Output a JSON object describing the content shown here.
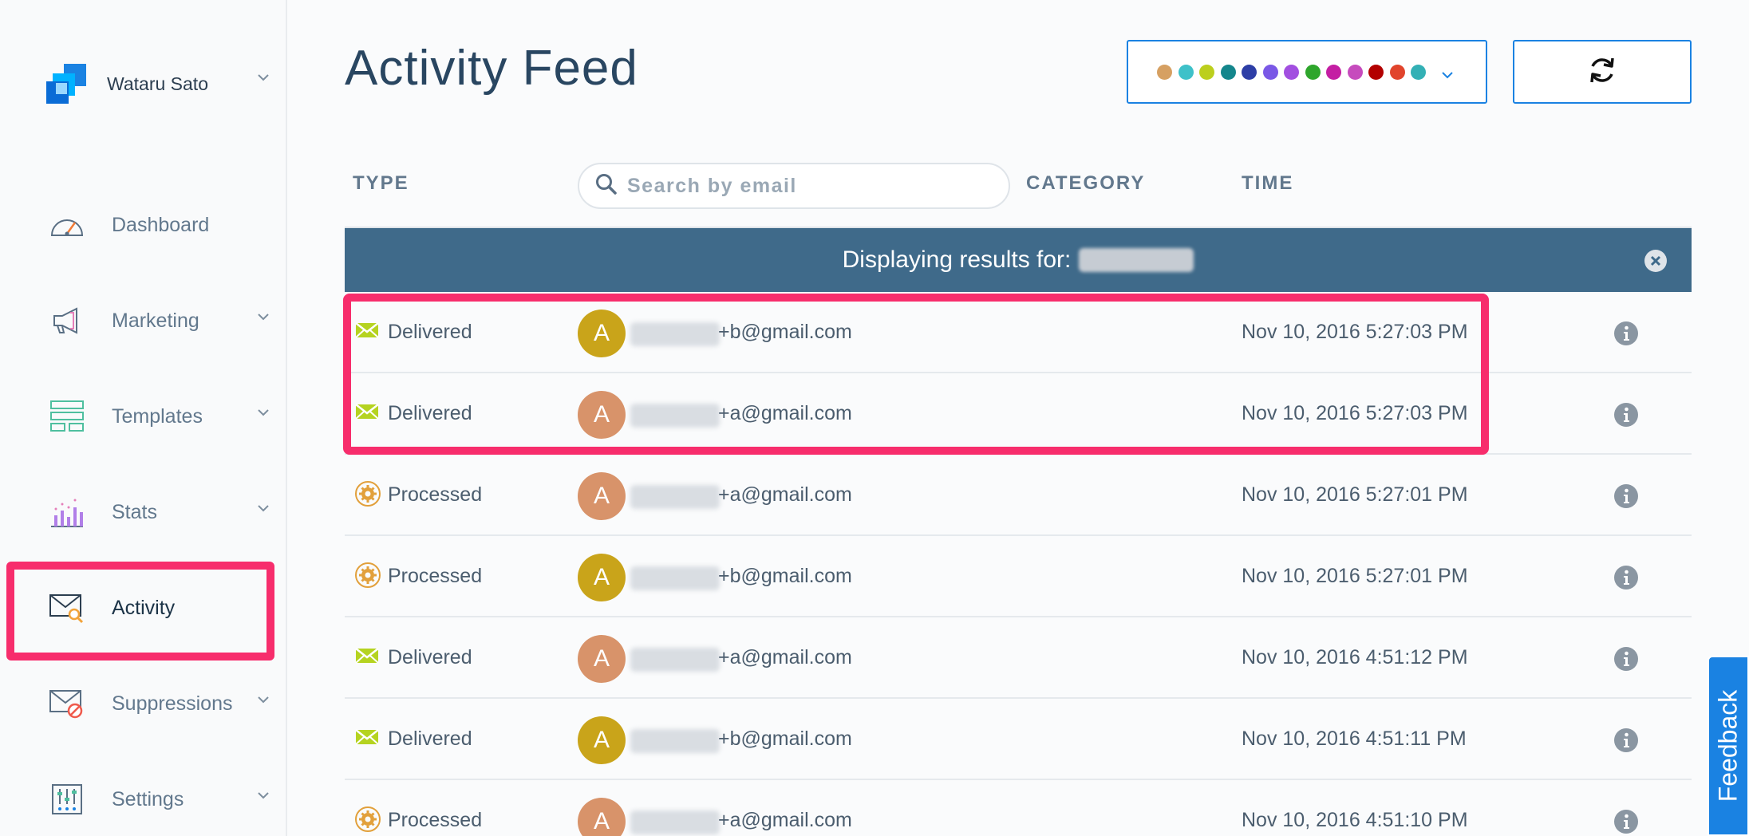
{
  "account": {
    "name": "Wataru Sato"
  },
  "nav": [
    {
      "label": "Dashboard"
    },
    {
      "label": "Marketing"
    },
    {
      "label": "Templates"
    },
    {
      "label": "Stats"
    },
    {
      "label": "Activity"
    },
    {
      "label": "Suppressions"
    },
    {
      "label": "Settings"
    }
  ],
  "header": {
    "title": "Activity Feed",
    "filter_colors": [
      "#d6a062",
      "#3ec1c9",
      "#bccf1d",
      "#14868c",
      "#2d3ea6",
      "#7a58e6",
      "#a24fe0",
      "#2ea62c",
      "#c41ea3",
      "#c64bbd",
      "#b30000",
      "#e1442c",
      "#33b0b5"
    ]
  },
  "columns": {
    "type": "TYPE",
    "search_placeholder": "Search by email",
    "category": "CATEGORY",
    "time": "TIME"
  },
  "banner": {
    "text": "Displaying results for:"
  },
  "rows": [
    {
      "type": "Delivered",
      "avatar": "A",
      "avatar_color": "#c9a41a",
      "email": "+b@gmail.com",
      "time": "Nov 10, 2016 5:27:03 PM"
    },
    {
      "type": "Delivered",
      "avatar": "A",
      "avatar_color": "#d8936a",
      "email": "+a@gmail.com",
      "time": "Nov 10, 2016 5:27:03 PM"
    },
    {
      "type": "Processed",
      "avatar": "A",
      "avatar_color": "#d8936a",
      "email": "+a@gmail.com",
      "time": "Nov 10, 2016 5:27:01 PM"
    },
    {
      "type": "Processed",
      "avatar": "A",
      "avatar_color": "#c9a41a",
      "email": "+b@gmail.com",
      "time": "Nov 10, 2016 5:27:01 PM"
    },
    {
      "type": "Delivered",
      "avatar": "A",
      "avatar_color": "#d8936a",
      "email": "+a@gmail.com",
      "time": "Nov 10, 2016 4:51:12 PM"
    },
    {
      "type": "Delivered",
      "avatar": "A",
      "avatar_color": "#c9a41a",
      "email": "+b@gmail.com",
      "time": "Nov 10, 2016 4:51:11 PM"
    },
    {
      "type": "Processed",
      "avatar": "A",
      "avatar_color": "#d8936a",
      "email": "+a@gmail.com",
      "time": "Nov 10, 2016 4:51:10 PM"
    }
  ],
  "feedback": {
    "label": "Feedback"
  }
}
